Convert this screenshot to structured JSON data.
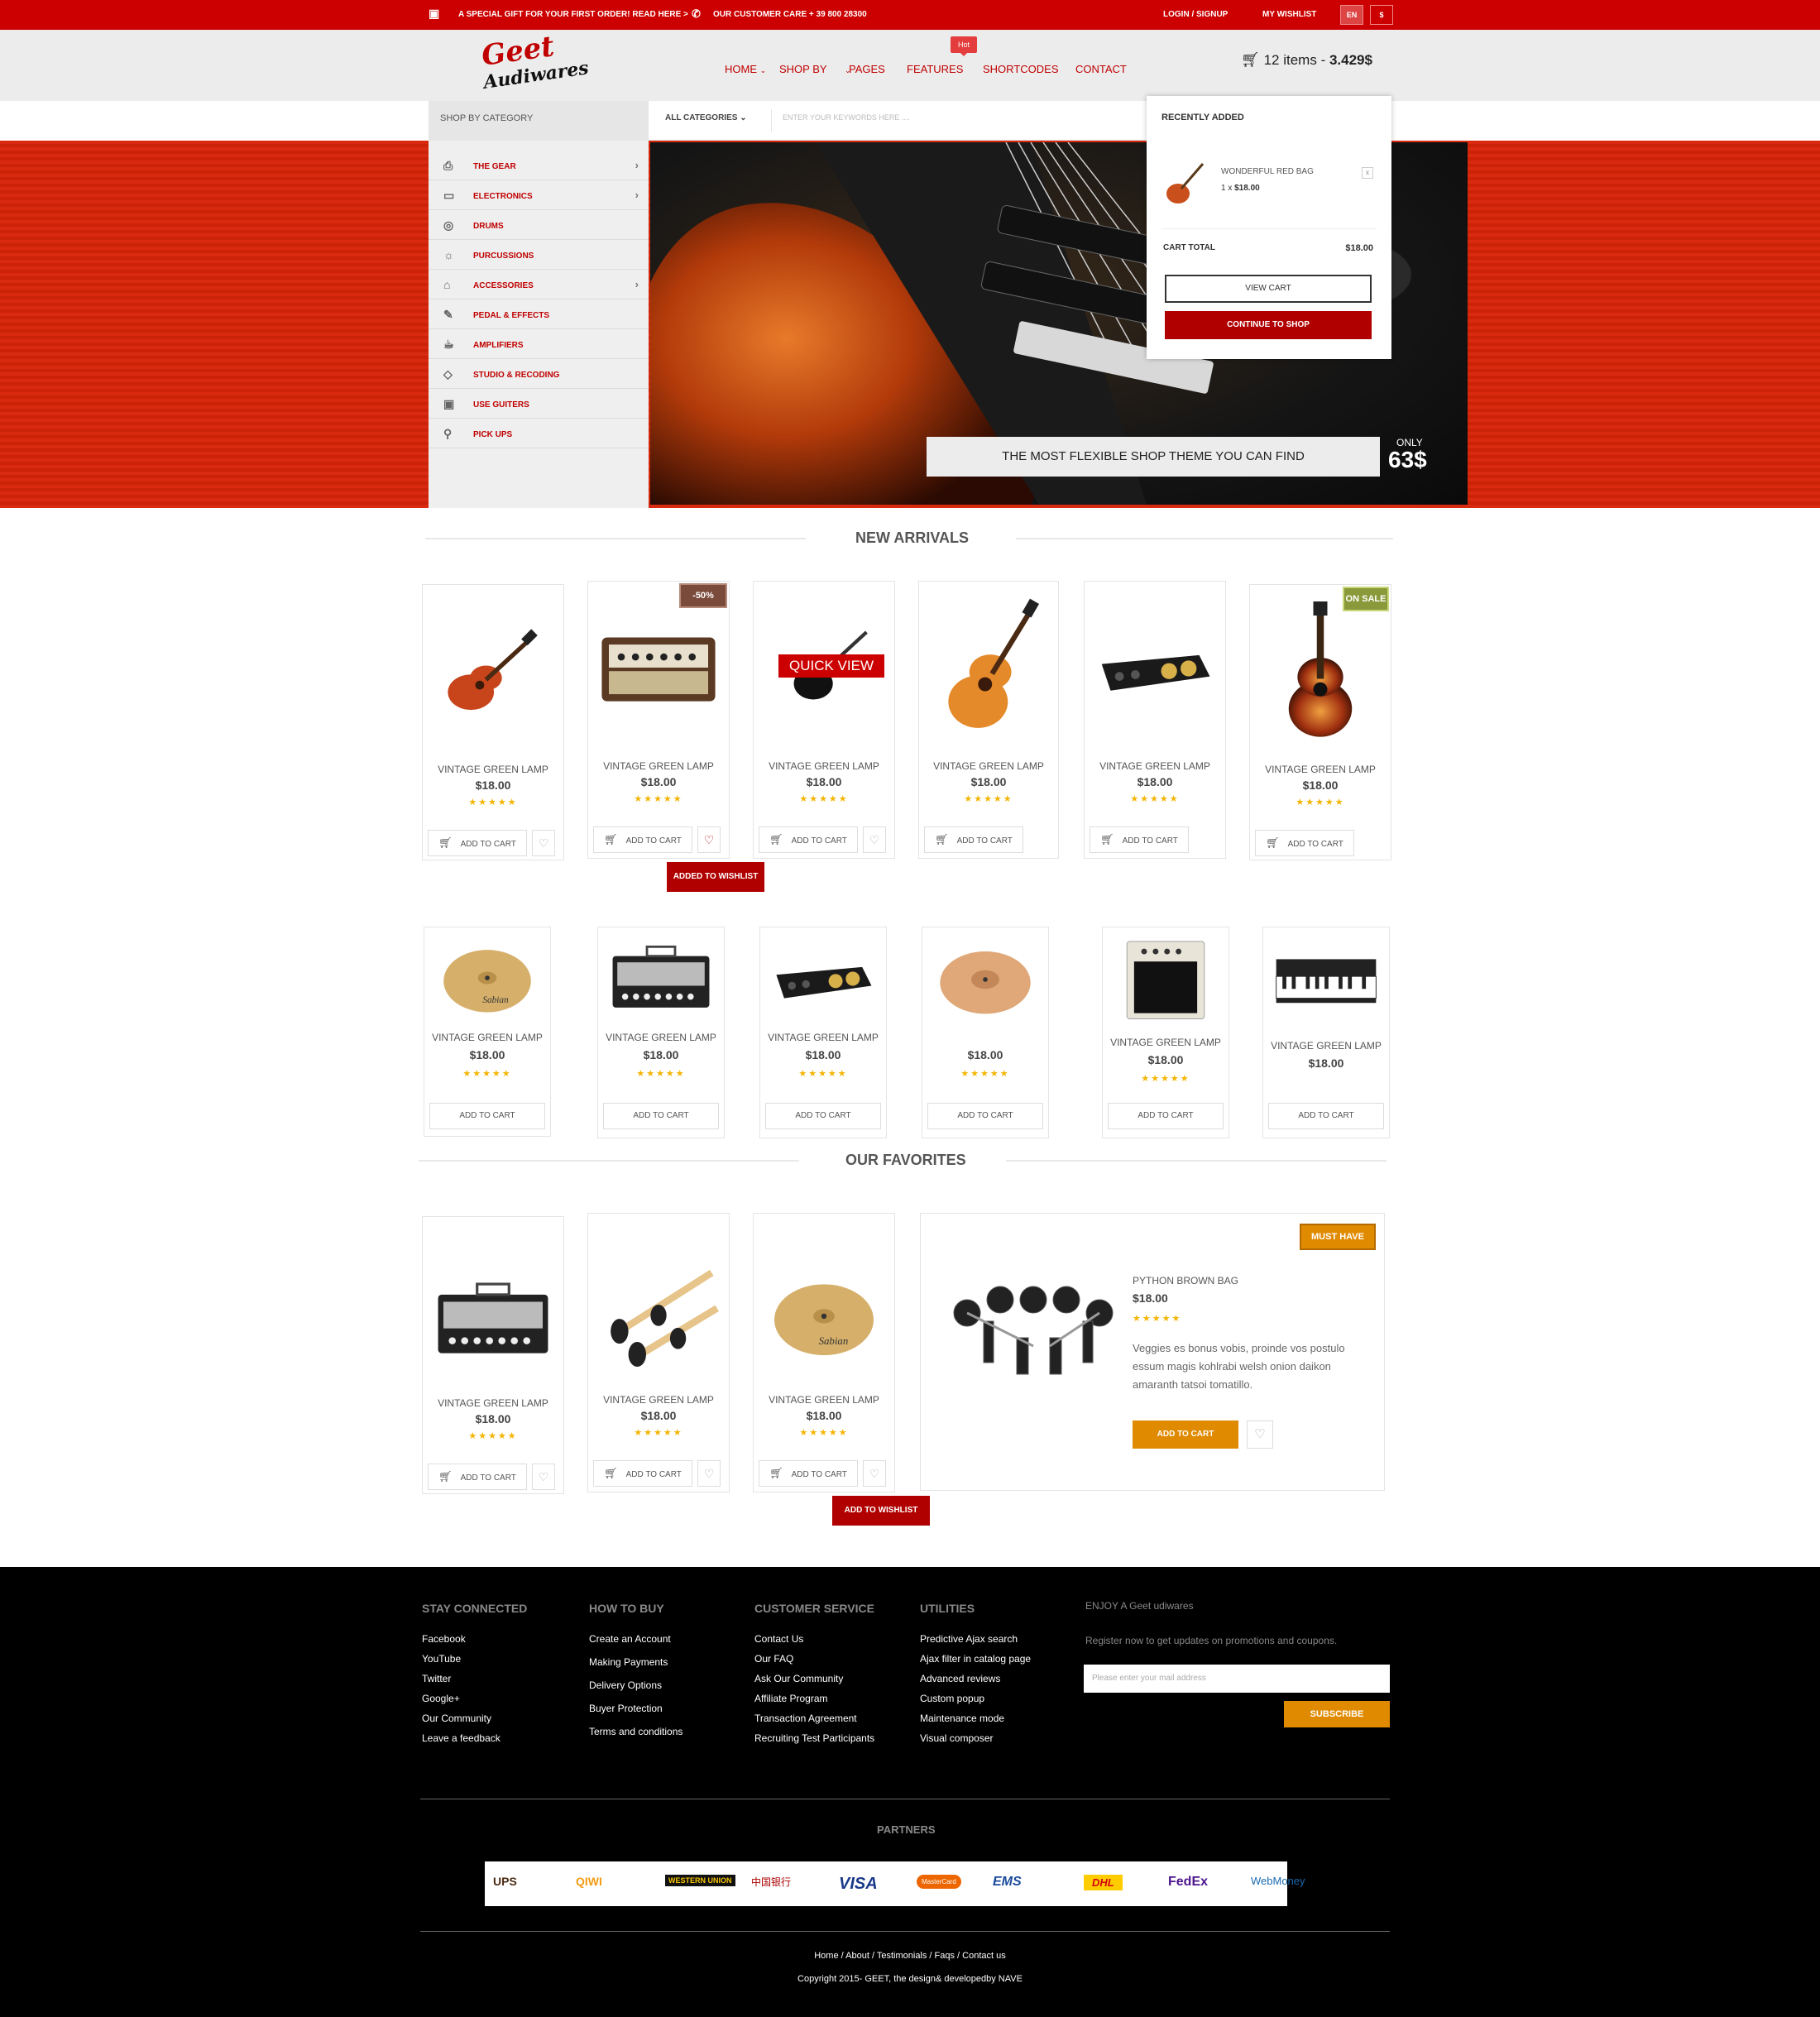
{
  "topbar": {
    "promo": "A SPECIAL GIFT FOR YOUR FIRST ORDER! READ HERE >",
    "care": "OUR CUSTOMER CARE + 39 800 28300",
    "login": "LOGIN / SIGNUP",
    "wishlist": "MY WISHLIST",
    "lang": "EN",
    "currency": "$"
  },
  "logo": {
    "line1": "Geet",
    "line2": "Audiwares"
  },
  "nav": {
    "items": [
      "HOME",
      "SHOP BY",
      "PAGES",
      "FEATURES",
      "SHORTCODES",
      "CONTACT"
    ],
    "hot_badge": "Hot"
  },
  "cart": {
    "count": "12 items",
    "sep": " - ",
    "total": "3.429$"
  },
  "search": {
    "shop_by_category": "SHOP BY CATEGORY",
    "all_categories": "ALL CATEGORIES",
    "placeholder": "ENTER YOUR KEYWORDS HERE ...."
  },
  "sidebar": {
    "items": [
      {
        "label": "THE GEAR",
        "icon": "printer-icon",
        "arrow": true
      },
      {
        "label": "ELECTRONICS",
        "icon": "monitor-icon",
        "arrow": true
      },
      {
        "label": "DRUMS",
        "icon": "drum-icon",
        "arrow": false
      },
      {
        "label": "PURCUSSIONS",
        "icon": "bulb-icon",
        "arrow": false
      },
      {
        "label": "ACCESSORIES",
        "icon": "bag-icon",
        "arrow": true
      },
      {
        "label": "PEDAL & EFFECTS",
        "icon": "rocket-icon",
        "arrow": false
      },
      {
        "label": "AMPLIFIERS",
        "icon": "cup-icon",
        "arrow": false
      },
      {
        "label": "STUDIO & RECODING",
        "icon": "diamond-icon",
        "arrow": false
      },
      {
        "label": "USE GUITERS",
        "icon": "gift-icon",
        "arrow": false
      },
      {
        "label": "PICK UPS",
        "icon": "bicycle-icon",
        "arrow": false
      }
    ]
  },
  "hero": {
    "tagline": "THE MOST FLEXIBLE SHOP THEME YOU CAN FIND",
    "only": "ONLY",
    "price": "63$"
  },
  "minicart": {
    "title": "RECENTLY ADDED",
    "item_name": "WONDERFUL RED BAG",
    "item_qty": "1 x",
    "item_price": "$18.00",
    "remove": "x",
    "total_label": "CART TOTAL",
    "total_value": "$18.00",
    "view_cart": "VIEW CART",
    "continue": "CONTINUE TO SHOP"
  },
  "new_arrivals": {
    "title": "NEW ARRIVALS",
    "row1": [
      {
        "name": "VINTAGE GREEN LAMP",
        "price": "$18.00",
        "stars": "★★★★★",
        "add": "ADD TO CART",
        "img": "classical-guitar"
      },
      {
        "name": "VINTAGE GREEN LAMP",
        "price": "$18.00",
        "stars": "★★★★★",
        "add": "ADD TO CART",
        "img": "amp-head",
        "badge": "-50%"
      },
      {
        "name": "VINTAGE GREEN LAMP",
        "price": "$18.00",
        "stars": "★★★★★",
        "add": "ADD TO CART",
        "img": "guitar-dark",
        "quick": "QUICK VIEW"
      },
      {
        "name": "VINTAGE GREEN LAMP",
        "price": "$18.00",
        "stars": "★★★★★",
        "add": "ADD TO CART",
        "img": "acoustic-guitar"
      },
      {
        "name": "VINTAGE GREEN LAMP",
        "price": "$18.00",
        "stars": "★★★★★",
        "add": "ADD TO CART",
        "img": "audio-interface"
      },
      {
        "name": "VINTAGE GREEN LAMP",
        "price": "$18.00",
        "stars": "★★★★★",
        "add": "ADD TO CART",
        "img": "sunburst-guitar",
        "badge": "ON SALE"
      }
    ],
    "wishlist_tip": "ADDED TO WISHLIST",
    "row2": [
      {
        "name": "VINTAGE GREEN LAMP",
        "price": "$18.00",
        "stars": "★★★★★",
        "add": "ADD TO CART",
        "img": "cymbal"
      },
      {
        "name": "VINTAGE GREEN LAMP",
        "price": "$18.00",
        "stars": "★★★★★",
        "add": "ADD TO CART",
        "img": "amp-head-black"
      },
      {
        "name": "VINTAGE GREEN LAMP",
        "price": "$18.00",
        "stars": "★★★★★",
        "add": "ADD TO CART",
        "img": "audio-interface"
      },
      {
        "name": "",
        "price": "$18.00",
        "stars": "★★★★★",
        "add": "ADD TO CART",
        "img": "china-cymbal"
      },
      {
        "name": "VINTAGE GREEN LAMP",
        "price": "$18.00",
        "stars": "★★★★★",
        "add": "ADD TO CART",
        "img": "combo-amp"
      },
      {
        "name": "VINTAGE GREEN LAMP",
        "price": "$18.00",
        "stars": "",
        "add": "ADD TO CART",
        "img": "keyboard"
      }
    ]
  },
  "favorites": {
    "title": "OUR FAVORITES",
    "items": [
      {
        "name": "VINTAGE GREEN LAMP",
        "price": "$18.00",
        "stars": "★★★★★",
        "add": "ADD TO CART",
        "img": "amp-head-black"
      },
      {
        "name": "VINTAGE GREEN LAMP",
        "price": "$18.00",
        "stars": "★★★★★",
        "add": "ADD TO CART",
        "img": "drumsticks"
      },
      {
        "name": "VINTAGE GREEN LAMP",
        "price": "$18.00",
        "stars": "★★★★★",
        "add": "ADD TO CART",
        "img": "cymbal"
      }
    ],
    "wishlist_tip": "ADD TO WISHLIST",
    "featured": {
      "badge": "MUST HAVE",
      "name": "PYTHON BROWN BAG",
      "price": "$18.00",
      "stars": "★★★★★",
      "desc": "Veggies es bonus vobis, proinde vos postulo essum magis kohlrabi welsh onion daikon amaranth tatsoi tomatillo.",
      "add": "ADD TO CART"
    }
  },
  "footer": {
    "cols": [
      {
        "title": "STAY CONNECTED",
        "links": [
          "Facebook",
          "YouTube",
          "Twitter",
          "Google+",
          "Our Community",
          "Leave a feedback"
        ]
      },
      {
        "title": "HOW TO BUY",
        "links": [
          "Create an Account",
          "Making Payments",
          "Delivery Options",
          "Buyer Protection",
          "Terms and conditions"
        ]
      },
      {
        "title": "CUSTOMER SERVICE",
        "links": [
          "Contact Us",
          "Our FAQ",
          "Ask Our Community",
          "Affiliate Program",
          "Transaction Agreement",
          "Recruiting Test Participants"
        ]
      },
      {
        "title": "UTILITIES",
        "links": [
          "Predictive Ajax search",
          "Ajax filter in catalog page",
          "Advanced reviews",
          "Custom popup",
          "Maintenance mode",
          "Visual composer"
        ]
      }
    ],
    "newsletter": {
      "title": "ENJOY A Geet udiwares",
      "text": "Register now to get updates on promotions and coupons.",
      "placeholder": "Please enter your mail address",
      "button": "SUBSCRIBE"
    },
    "partners_title": "PARTNERS",
    "partners": [
      "UPS",
      "QIWI",
      "WESTERN UNION",
      "中国银行",
      "VISA",
      "MasterCard",
      "EMS",
      "DHL",
      "FedEx",
      "WebMoney"
    ],
    "bottom_links": "Home / About / Testimonials / Faqs / Contact us",
    "copyright": "Copyright 2015- GEET, the design& developedby NAVE"
  },
  "colors": {
    "brand_red": "#cc0000",
    "accent_orange": "#e08a00",
    "footer_bg": "#000000"
  }
}
